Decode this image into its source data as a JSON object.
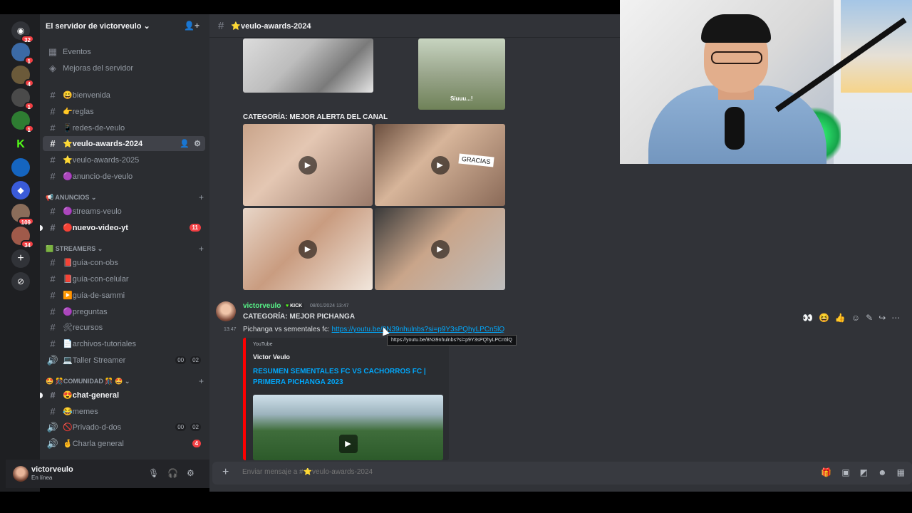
{
  "server": {
    "name": "El servidor de victorveulo ⌄"
  },
  "rail_badges": [
    "32",
    "1",
    "4",
    "1",
    "1",
    "109",
    "34"
  ],
  "sidebar": {
    "top_items": [
      {
        "label": "Eventos",
        "icon": "calendar-icon"
      },
      {
        "label": "Mejoras del servidor",
        "icon": "boost-icon"
      }
    ],
    "channels_top": [
      {
        "label": "😀bienvenida"
      },
      {
        "label": "👉reglas"
      },
      {
        "label": "📱redes-de-veulo"
      },
      {
        "label": "⭐veulo-awards-2024"
      },
      {
        "label": "⭐veulo-awards-2025"
      },
      {
        "label": "🟣anuncio-de-veulo"
      }
    ],
    "cat_anuncios": "📢 ANUNCIOS ⌄",
    "channels_anuncios": [
      {
        "label": "🟣streams-veulo"
      },
      {
        "label": "🔴nuevo-video-yt",
        "badge": "11"
      }
    ],
    "cat_streamers": "🟩 STREAMERS ⌄",
    "channels_streamers": [
      {
        "label": "📕guía-con-obs"
      },
      {
        "label": "📕guía-con-celular"
      },
      {
        "label": "▶️guía-de-sammi"
      },
      {
        "label": "🟣preguntas"
      },
      {
        "label": "🛠recursos"
      },
      {
        "label": "📄archivos-tutoriales"
      },
      {
        "label": "💻Taller Streamer",
        "p1": "00",
        "p2": "02"
      }
    ],
    "cat_comunidad": "🤩 🎊COMUNIDAD 🎊 🤩 ⌄",
    "channels_comunidad": [
      {
        "label": "😍chat-general"
      },
      {
        "label": "😂memes"
      },
      {
        "label": "🚫Privado-d-dos",
        "p1": "00",
        "p2": "02"
      },
      {
        "label": "🤞Charla general",
        "badge": "4"
      }
    ]
  },
  "user": {
    "name": "victorveulo",
    "status": "En línea"
  },
  "chat": {
    "channel_title": "⭐veulo-awards-2024",
    "category_label": "CATEGORÍA: MEJOR ALERTA DEL CANAL",
    "sticker_caption": "Siuuu...!",
    "gracias": "GRACIAS",
    "message": {
      "author": "victorveulo",
      "kick": "KICK",
      "timestamp": "08/01/2024 13:47",
      "line1": "CATEGORÍA: MEJOR PICHANGA",
      "hover_time": "13:47",
      "line2_prefix": "Pichanga vs sementales fc: ",
      "link": "https://youtu.be/8N39nhulnbs?si=p9Y3sPQhyLPCn5lQ",
      "tooltip": "https://youtu.be/8N39nhulnbs?si=p9Y3sPQhyLPCn5lQ"
    },
    "embed": {
      "provider": "YouTube",
      "author": "Victor Veulo",
      "title": "RESUMEN SEMENTALES FC  VS CACHORROS FC | PRIMERA PICHANGA 2023"
    },
    "composer_placeholder": "Enviar mensaje a #⭐veulo-awards-2024"
  },
  "colors": {
    "accent_link": "#00a8fc",
    "author_green": "#57f287",
    "badge_red": "#f23f43",
    "youtube_red": "#ff0000"
  }
}
